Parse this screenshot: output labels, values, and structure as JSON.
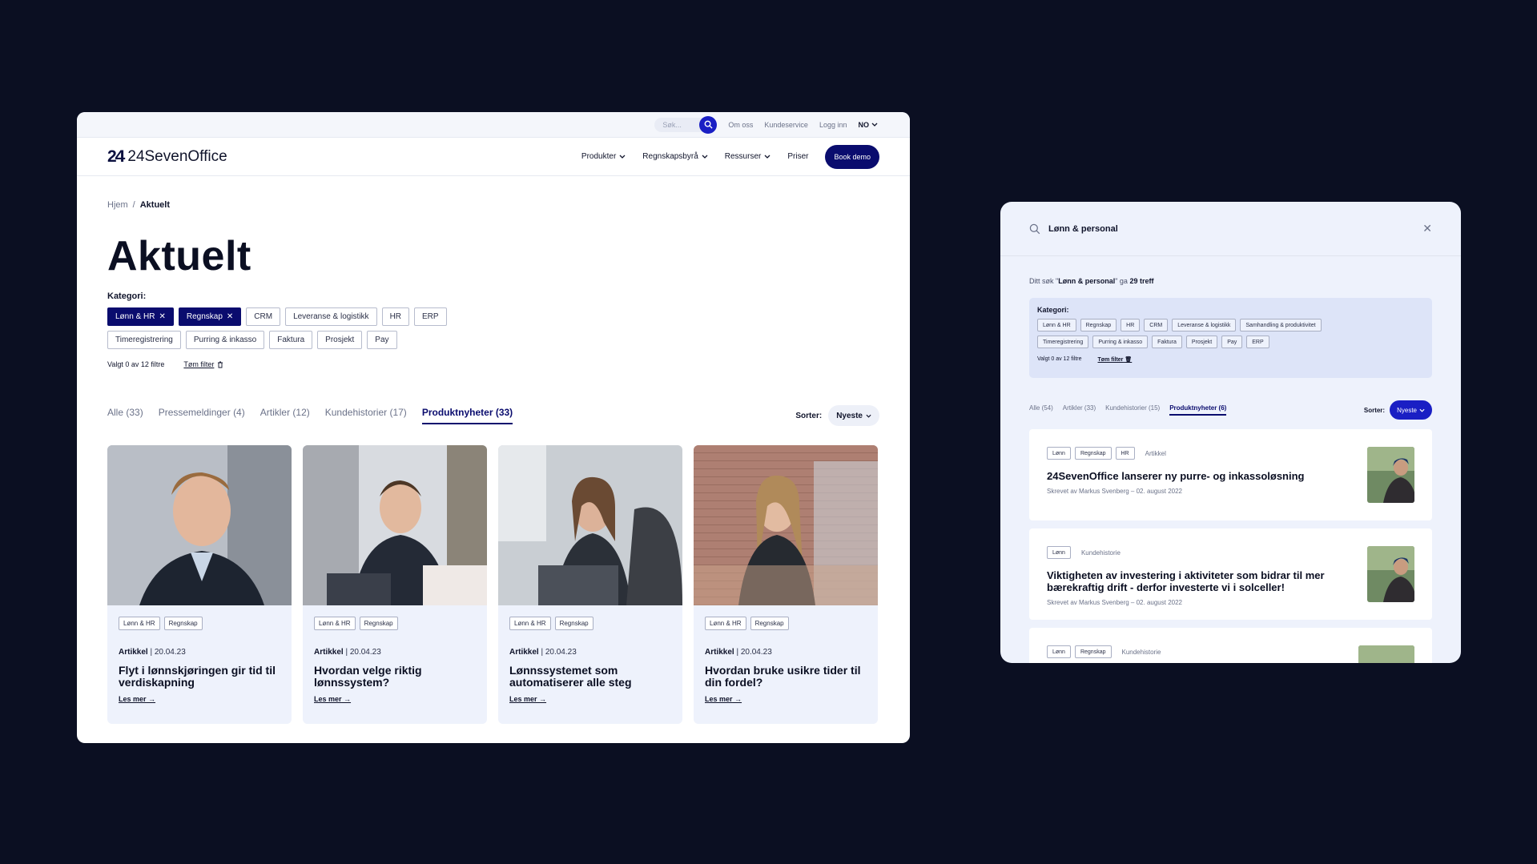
{
  "left": {
    "topbar": {
      "search_placeholder": "Søk...",
      "links": [
        "Om oss",
        "Kundeservice",
        "Logg inn"
      ],
      "lang": "NO"
    },
    "nav": {
      "logo_mark": "24",
      "logo_text": "24SevenOffice",
      "items": [
        "Produkter",
        "Regnskapsbyrå",
        "Ressurser"
      ],
      "plain": "Priser",
      "cta": "Book demo"
    },
    "breadcrumb": {
      "home": "Hjem",
      "separator": "/",
      "current": "Aktuelt"
    },
    "title": "Aktuelt",
    "category_label": "Kategori:",
    "chips_row1": [
      {
        "label": "Lønn & HR",
        "active": true
      },
      {
        "label": "Regnskap",
        "active": true
      },
      {
        "label": "CRM",
        "active": false
      },
      {
        "label": "Leveranse & logistikk",
        "active": false
      },
      {
        "label": "HR",
        "active": false
      },
      {
        "label": "ERP",
        "active": false
      }
    ],
    "chips_row2": [
      "Timeregistrering",
      "Purring & inkasso",
      "Faktura",
      "Prosjekt",
      "Pay"
    ],
    "selected_text": "Valgt 0 av 12 filtre",
    "clear_filter": "Tøm filter",
    "tabs": [
      "Alle (33)",
      "Pressemeldinger (4)",
      "Artikler (12)",
      "Kundehistorier (17)",
      "Produktnyheter (33)"
    ],
    "active_tab": 4,
    "sort_label": "Sorter:",
    "sort_value": "Nyeste",
    "cards": [
      {
        "tags": [
          "Lønn & HR",
          "Regnskap"
        ],
        "type": "Artikkel",
        "date": "20.04.23",
        "title": "Flyt i lønnskjøringen gir tid til verdiskapning",
        "link": "Les mer"
      },
      {
        "tags": [
          "Lønn & HR",
          "Regnskap"
        ],
        "type": "Artikkel",
        "date": "20.04.23",
        "title": "Hvordan velge riktig lønnssystem?",
        "link": "Les mer"
      },
      {
        "tags": [
          "Lønn & HR",
          "Regnskap"
        ],
        "type": "Artikkel",
        "date": "20.04.23",
        "title": "Lønnssystemet som automatiserer alle steg",
        "link": "Les mer"
      },
      {
        "tags": [
          "Lønn & HR",
          "Regnskap"
        ],
        "type": "Artikkel",
        "date": "20.04.23",
        "title": "Hvordan bruke usikre tider til din fordel?",
        "link": "Les mer"
      }
    ]
  },
  "right": {
    "query": "Lønn & personal",
    "count_prefix": "Ditt søk \"",
    "count_query": "Lønn & personal",
    "count_mid": "\" ga ",
    "count_hits": "29 treff",
    "category_label": "Kategori:",
    "chips": [
      "Lønn & HR",
      "Regnskap",
      "HR",
      "CRM",
      "Leveranse & logistikk",
      "Samhandling & produktivitet",
      "Timeregistrering",
      "Purring & inkasso",
      "Faktura",
      "Prosjekt",
      "Pay",
      "ERP"
    ],
    "selected_text": "Valgt 0 av 12 filtre",
    "clear_filter": "Tøm filter",
    "tabs": [
      "Alle (54)",
      "Artikler (33)",
      "Kundehistorier (15)",
      "Produktnyheter (6)"
    ],
    "active_tab": 3,
    "sort_label": "Sorter:",
    "sort_value": "Nyeste",
    "results": [
      {
        "tags": [
          "Lønn",
          "Regnskap",
          "HR"
        ],
        "type": "Artikkel",
        "title": "24SevenOffice lanserer ny purre- og inkassoløsning",
        "byline": "Skrevet av Markus Svenberg – 02. august 2022"
      },
      {
        "tags": [
          "Lønn"
        ],
        "type": "Kundehistorie",
        "title": "Viktigheten av investering i aktiviteter som bidrar til mer bærekraftig drift - derfor investerte vi i solceller!",
        "byline": "Skrevet av Markus Svenberg – 02. august 2022"
      },
      {
        "tags": [
          "Lønn",
          "Regnskap"
        ],
        "type": "Kundehistorie",
        "title": "",
        "byline": ""
      }
    ]
  },
  "colors": {
    "background": "#0b0f22",
    "brand_navy": "#0a0c6e",
    "brand_blue": "#1a1fc4",
    "card_bg": "#eef2fc"
  }
}
